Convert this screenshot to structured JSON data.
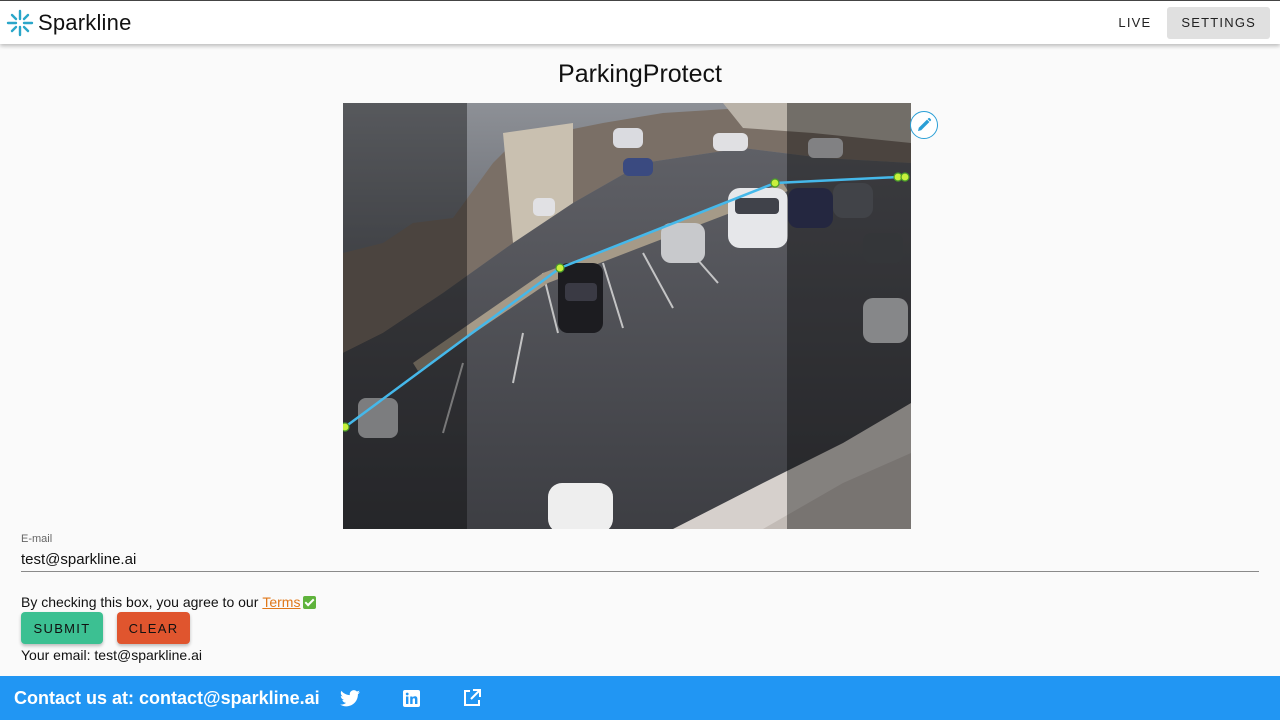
{
  "header": {
    "brand_name": "Sparkline",
    "nav": [
      {
        "label": "LIVE"
      },
      {
        "label": "SETTINGS"
      }
    ]
  },
  "page": {
    "title": "ParkingProtect"
  },
  "camera": {
    "edit_icon": "pencil-icon"
  },
  "form": {
    "email_label": "E-mail",
    "email_value": "test@sparkline.ai",
    "consent_text": "By checking this box, you agree to our",
    "terms_link": "Terms",
    "submit_label": "SUBMIT",
    "clear_label": "CLEAR",
    "your_email_text": "Your email: test@sparkline.ai"
  },
  "footer": {
    "contact_text": "Contact us at: contact@sparkline.ai",
    "icons": [
      "twitter-icon",
      "linkedin-icon",
      "external-link-icon"
    ]
  },
  "colors": {
    "accent": "#2196f3",
    "submit": "#3cc092",
    "clear": "#e0552e",
    "terms": "#e0781a",
    "line": "#45b8ea",
    "point": "#c8f03c"
  }
}
